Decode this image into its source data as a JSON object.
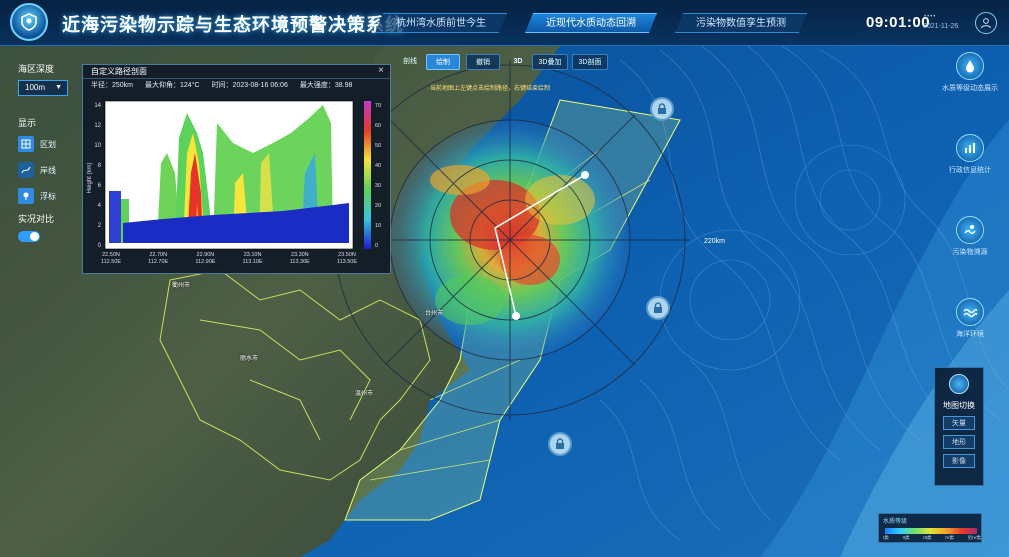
{
  "app": {
    "title": "近海污染物示踪与生态环境预警决策系统",
    "logo_icon": "shield-logo-icon"
  },
  "nav_tabs": [
    {
      "label": "杭州湾水质前世今生",
      "active": false
    },
    {
      "label": "近现代水质动态回溯",
      "active": true
    },
    {
      "label": "污染物数值孪生预测",
      "active": false
    }
  ],
  "header": {
    "time": "09:01:00",
    "date": "2021-11-26",
    "user_icon": "user-icon"
  },
  "left_panel": {
    "depth_label": "海区深度",
    "depth_value": "100m",
    "display_label": "显示",
    "display_options": [
      {
        "label": "区划",
        "icon": "zoning-icon"
      },
      {
        "label": "岸线",
        "icon": "coastline-icon"
      },
      {
        "label": "浮标",
        "icon": "buoy-icon"
      }
    ],
    "compare_label": "实况对比",
    "compare_on": true
  },
  "profile_panel": {
    "title": "自定义路径剖面",
    "close": "×",
    "radius": "半径：250km",
    "max_elev": "最大仰角：124°C",
    "time": "时间：2023-08-16 06:06",
    "max_intensity": "最大强度：38.98",
    "y_axis_label": "Height (km)",
    "y_ticks": [
      "14",
      "12",
      "10",
      "8",
      "6",
      "4",
      "2",
      "0"
    ],
    "colorbar_ticks": [
      "70",
      "60",
      "50",
      "40",
      "30",
      "20",
      "10",
      "0"
    ],
    "x_ticks": [
      {
        "lat": "22.50N",
        "lon": "112.50E"
      },
      {
        "lat": "22.70N",
        "lon": "112.70E"
      },
      {
        "lat": "22.90N",
        "lon": "112.90E"
      },
      {
        "lat": "23.10N",
        "lon": "113.10E"
      },
      {
        "lat": "23.30N",
        "lon": "113.30E"
      },
      {
        "lat": "23.50N",
        "lon": "113.50E"
      }
    ]
  },
  "toolbar": {
    "section_label": "剖线",
    "draw": "绘制",
    "undo": "撤销",
    "mode_3d": "3D",
    "overlay_3d": "3D叠加",
    "profile_3d": "3D剖面",
    "tip": "·当前地图上左键点击绘制路径，右键结束绘制"
  },
  "radar": {
    "range_label": "220km"
  },
  "right_panel": [
    {
      "label": "水质等级动态展示",
      "icon": "water-quality-icon"
    },
    {
      "label": "行政信息统计",
      "icon": "chart-icon"
    },
    {
      "label": "污染物溯源",
      "icon": "pollution-icon"
    },
    {
      "label": "海洋环境",
      "icon": "wave-icon"
    }
  ],
  "map_switch": {
    "title": "地图切换",
    "icon": "globe-icon",
    "options": [
      "矢量",
      "地形",
      "影像"
    ]
  },
  "legend": {
    "title": "水质等级",
    "labels": [
      "I类",
      "II类",
      "III类",
      "IV类",
      "劣IV类"
    ]
  },
  "map_labels": [
    {
      "text": "衢州市"
    },
    {
      "text": "丽水市"
    },
    {
      "text": "台州市"
    },
    {
      "text": "温州市"
    }
  ]
}
